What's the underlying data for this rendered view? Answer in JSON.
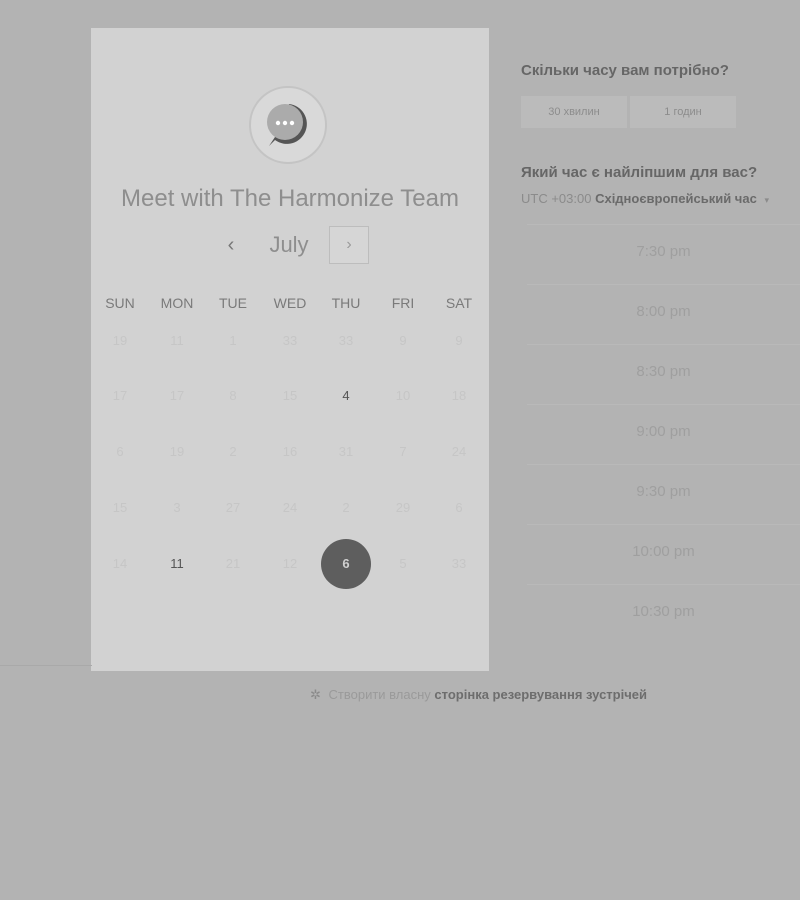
{
  "card": {
    "title": "Meet with The Harmonize Team",
    "avatar_icon": "chat-bubble-icon",
    "month": "July",
    "prev_label": "‹",
    "next_label": "›",
    "weekdays": [
      "SUN",
      "MON",
      "TUE",
      "WED",
      "THU",
      "FRI",
      "SAT"
    ],
    "weeks": [
      [
        "19",
        "11",
        "1",
        "33",
        "33",
        "9",
        "9"
      ],
      [
        "17",
        "17",
        "8",
        "15",
        "4",
        "10",
        "18"
      ],
      [
        "6",
        "19",
        "2",
        "16",
        "31",
        "7",
        "24"
      ],
      [
        "15",
        "3",
        "27",
        "24",
        "2",
        "29",
        "6"
      ],
      [
        "14",
        "11",
        "21",
        "12",
        "6",
        "5",
        "33"
      ]
    ],
    "available_days": [
      {
        "week": 1,
        "day": 4
      },
      {
        "week": 4,
        "day": 1
      }
    ],
    "selected_day": {
      "week": 4,
      "day": 4
    }
  },
  "duration": {
    "question": "Скільки часу вам потрібно?",
    "options": [
      "30 хвилин",
      "1 годин"
    ]
  },
  "time": {
    "question": "Який час є найліпшим для вас?",
    "tz_offset": "UTC +03:00",
    "tz_name": "Східноєвропейський час",
    "tz_caret": "▾",
    "slots": [
      "7:30 pm",
      "8:00 pm",
      "8:30 pm",
      "9:00 pm",
      "9:30 pm",
      "10:00 pm",
      "10:30 pm"
    ]
  },
  "footer": {
    "icon": "sprocket-icon",
    "prefix": "Створити власну",
    "link": "сторінка резервування зустрічей"
  },
  "colors": {
    "background": "#b3b3b3",
    "card": "#d2d2d2",
    "selected_day": "#5e5e5e"
  }
}
